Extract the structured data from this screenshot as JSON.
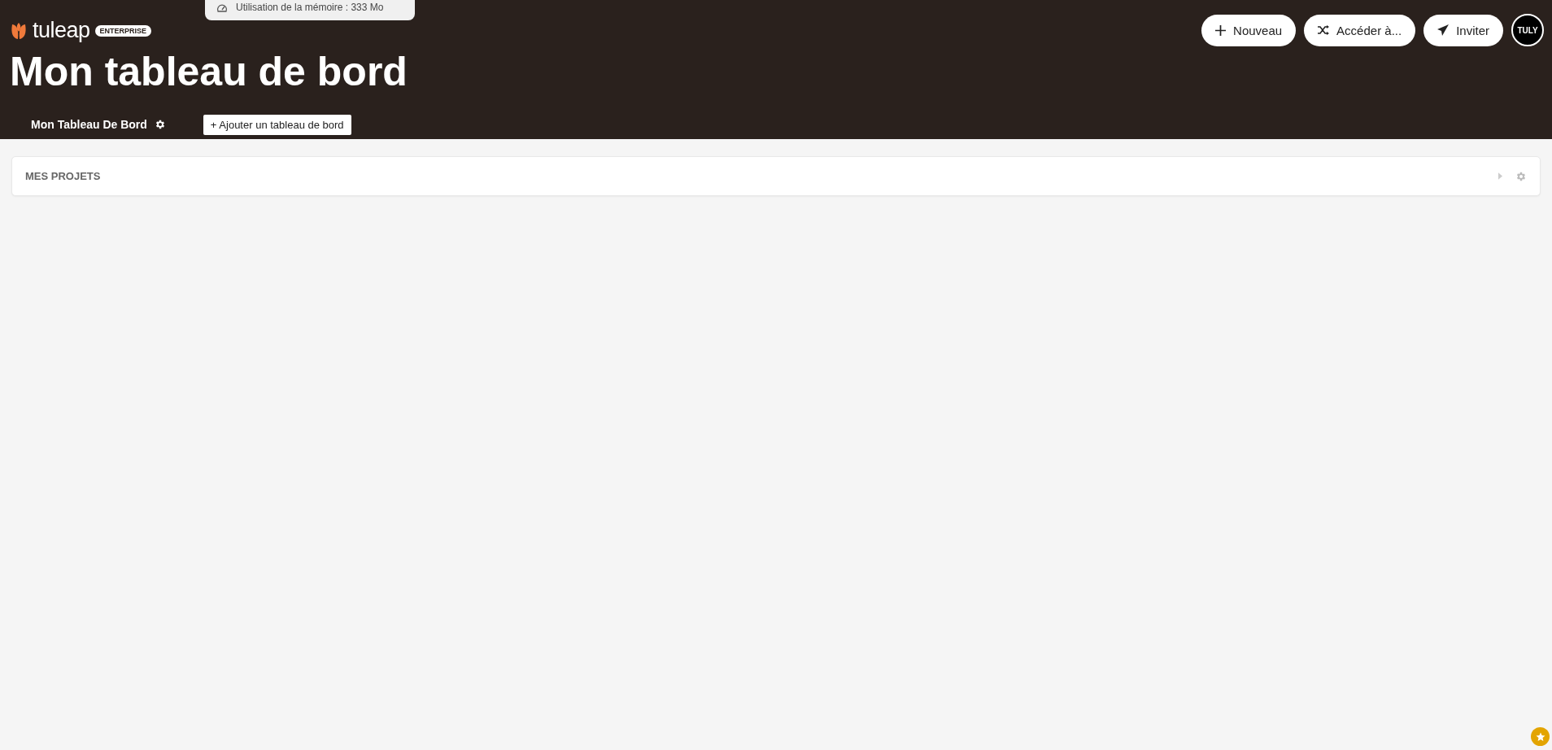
{
  "memory_popup": {
    "text": "Utilisation de la mémoire : 333 Mo"
  },
  "logo": {
    "name": "tuleap",
    "edition": "ENTERPRISE"
  },
  "header_buttons": [
    {
      "kind": "new",
      "label": "Nouveau"
    },
    {
      "kind": "switch",
      "label": "Accéder à..."
    },
    {
      "kind": "invite",
      "label": "Inviter"
    }
  ],
  "avatar": {
    "initials": "TULY"
  },
  "page_title": "Mon tableau de bord",
  "dashboard_tabs": [
    {
      "label": "Mon Tableau De Bord",
      "selected": true
    }
  ],
  "add_dashboard_button": "+ Ajouter un tableau de bord",
  "widgets": [
    {
      "title": "MES PROJETS"
    }
  ]
}
